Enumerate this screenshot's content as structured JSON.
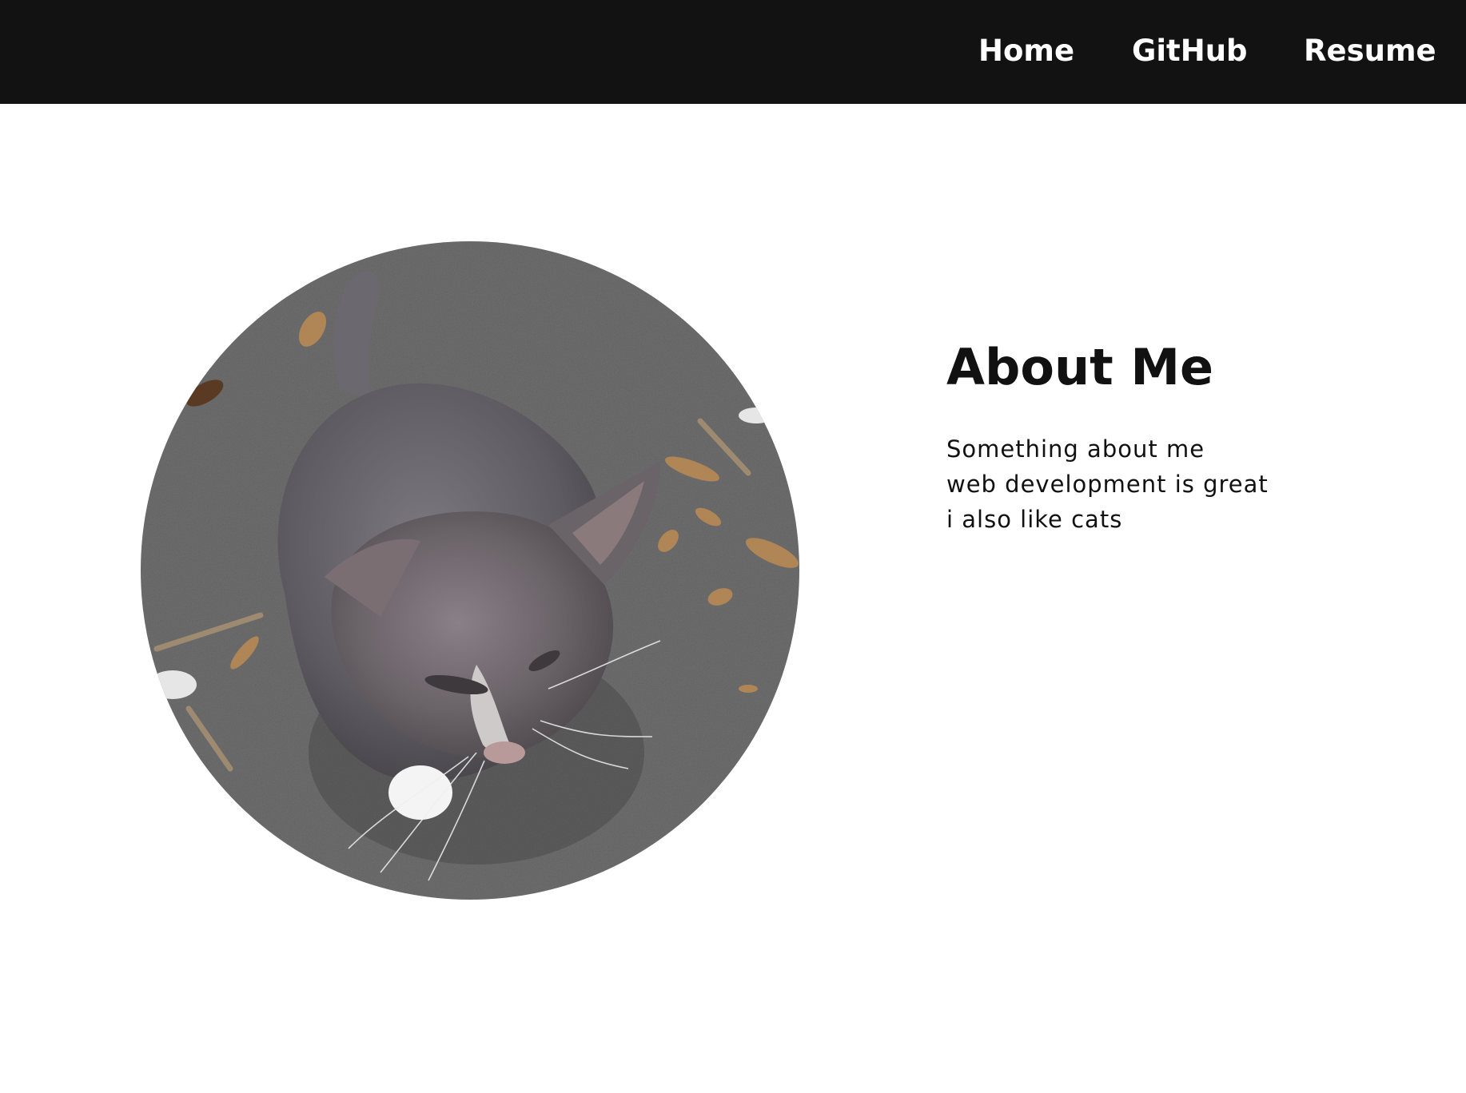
{
  "nav": {
    "links": [
      {
        "label": "Home"
      },
      {
        "label": "GitHub"
      },
      {
        "label": "Resume"
      }
    ]
  },
  "about": {
    "title": "About Me",
    "lines": [
      "Something about me",
      "web development is great",
      "i also like cats"
    ]
  },
  "colors": {
    "nav_background": "#121212",
    "nav_text": "#ffffff",
    "page_background": "#ffffff",
    "text": "#111111"
  }
}
